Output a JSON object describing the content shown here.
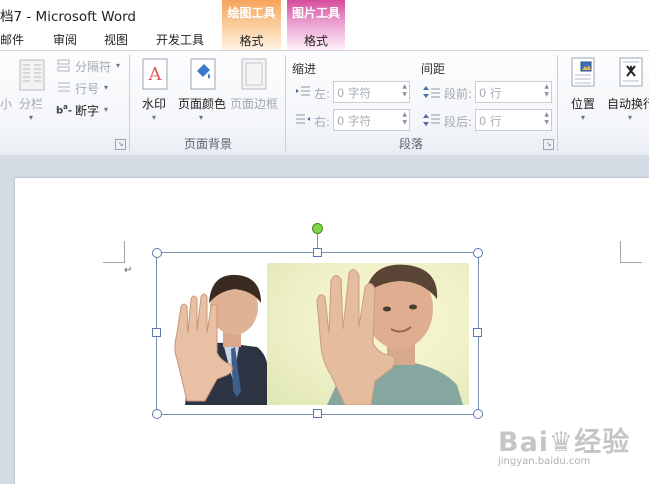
{
  "window": {
    "title": "档7 - Microsoft Word"
  },
  "context_tabs": [
    {
      "title": "绘图工具",
      "tab": "格式"
    },
    {
      "title": "图片工具",
      "tab": "格式"
    }
  ],
  "tabs": [
    "邮件",
    "审阅",
    "视图",
    "开发工具"
  ],
  "ribbon": {
    "page_setup": {
      "size_label": "小",
      "columns_label": "分栏",
      "breaks_label": "分隔符",
      "line_numbers_label": "行号",
      "hyphenation_label": "断字"
    },
    "page_background": {
      "group_label": "页面背景",
      "watermark_label": "水印",
      "page_color_label": "页面颜色",
      "page_borders_label": "页面边框"
    },
    "paragraph": {
      "group_label": "段落",
      "indent_header": "缩进",
      "spacing_header": "间距",
      "indent_left_label": "左:",
      "indent_left_value": "0 字符",
      "indent_right_label": "右:",
      "indent_right_value": "0 字符",
      "space_before_label": "段前:",
      "space_before_value": "0 行",
      "space_after_label": "段后:",
      "space_after_value": "0 行"
    },
    "arrange": {
      "position_label": "位置",
      "wrap_text_label": "自动换行"
    }
  },
  "document": {
    "paragraph_mark": "↵"
  },
  "watermark": {
    "main": "Bai♛经验",
    "sub": "jingyan.baidu.com"
  },
  "colors": {
    "drawing_tools_accent": "#f6a45b",
    "picture_tools_accent": "#d44d9c",
    "rotation_handle": "#7fd44c",
    "selection_frame": "#7a8fb0"
  }
}
